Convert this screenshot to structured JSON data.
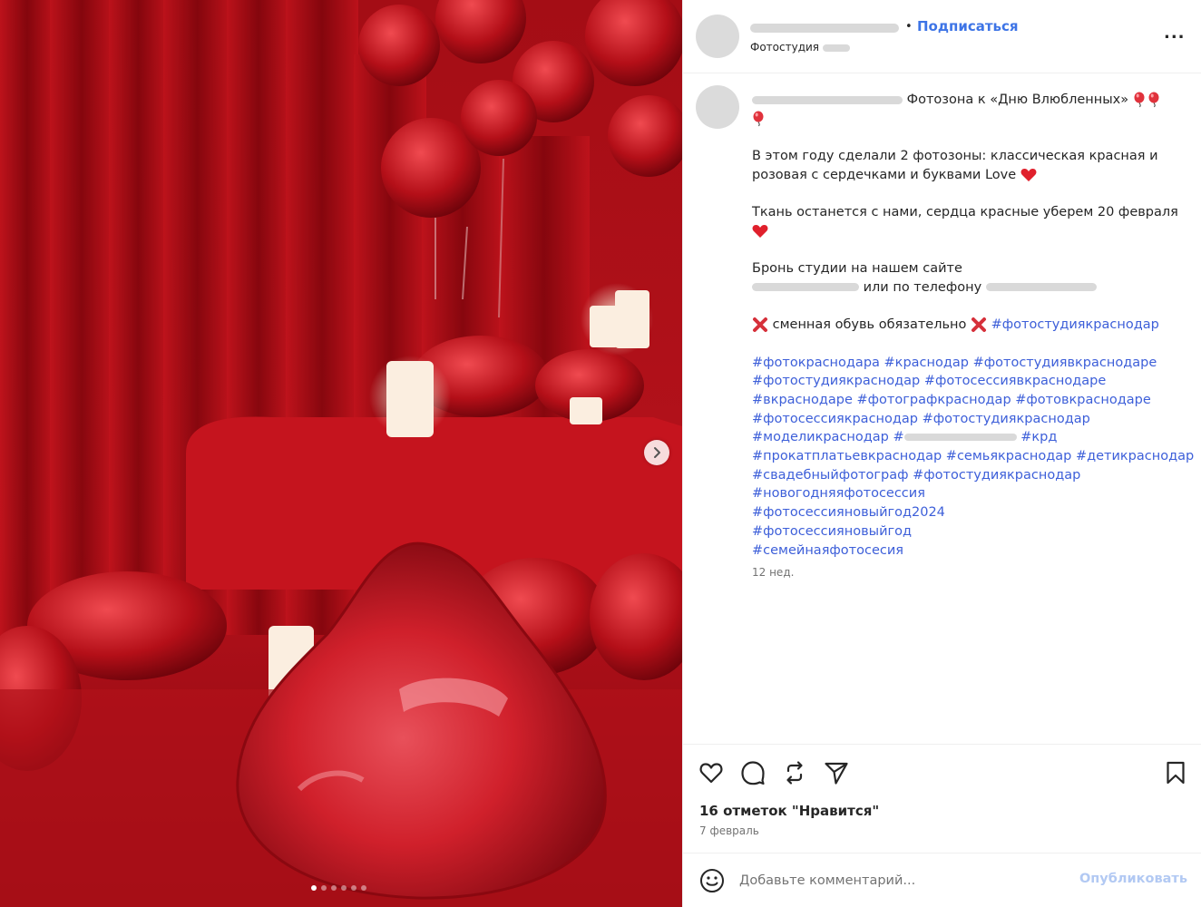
{
  "post": {
    "slides": {
      "total": 6,
      "active": 1
    }
  },
  "header": {
    "separator": "•",
    "follow_label": "Подписаться",
    "subtitle": "Фотостудия",
    "more_label": "..."
  },
  "caption": {
    "title": "Фотозона к «Дню Влюбленных»",
    "p1_line1": "В этом году сделали 2 фотозоны: классическая красная и",
    "p1_line2": "розовая с сердечками и буквами Love",
    "p2_line1": "Ткань останется с нами, сердца красные уберем 20 февраля",
    "p3_line1": "Бронь студии на нашем сайте",
    "p3_line2": "или по телефону",
    "p4_text": "сменная обувь обязательно",
    "p4_tag": "#фотостудиякраснодар",
    "hashtags": {
      "l1": [
        "#фотокраснодара",
        "#краснодар",
        "#фотостудиявкраснодаре"
      ],
      "l2": [
        "#фотостудиякраснодар",
        "#фотосессиявкраснодаре"
      ],
      "l3": [
        "#вкраснодаре",
        "#фотографкраснодар",
        "#фотовкраснодаре"
      ],
      "l4": [
        "#фотосессиякраснодар",
        "#фотостудиякраснодар"
      ],
      "l5a": "#моделикраснодар #",
      "l5b": "#крд",
      "l6": [
        "#прокатплатьевкраснодар",
        "#семьякраснодар",
        "#детикраснодар"
      ],
      "l7": [
        "#свадебныйфотограф",
        "#фотостудиякраснодар"
      ],
      "l8": "#новогодняяфотосессия",
      "l9": "#фотосессияновыйгод2024",
      "l10": "#фотосессияновыйгод",
      "l11": "#семейнаяфотосесия"
    },
    "time_ago": "12 нед."
  },
  "actions": {
    "like_icon": "heart-icon",
    "comment_icon": "comment-icon",
    "repost_icon": "repost-icon",
    "share_icon": "send-icon",
    "save_icon": "bookmark-icon",
    "likes_text": "16 отметок \"Нравится\"",
    "date": "7 февраль"
  },
  "comment": {
    "placeholder": "Добавьте комментарий...",
    "publish_label": "Опубликовать"
  },
  "colors": {
    "link": "#3d5fd9",
    "follow": "#3d74e6",
    "publish_disabled": "#b2c9f3",
    "photo_red": "#9d0a14"
  }
}
